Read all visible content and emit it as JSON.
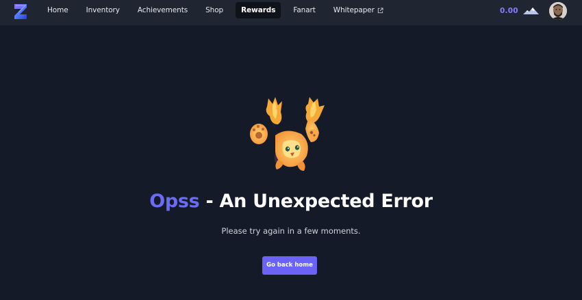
{
  "nav": {
    "items": [
      {
        "label": "Home",
        "active": false
      },
      {
        "label": "Inventory",
        "active": false
      },
      {
        "label": "Achievements",
        "active": false
      },
      {
        "label": "Shop",
        "active": false
      },
      {
        "label": "Rewards",
        "active": true
      },
      {
        "label": "Fanart",
        "active": false
      },
      {
        "label": "Whitepaper",
        "active": false,
        "icon": "external-link-icon"
      }
    ]
  },
  "account": {
    "balance": "0.00",
    "balance_icon": "mountain-token-icon",
    "avatar_icon": "user-avatar"
  },
  "error": {
    "mascot_icon": "fire-creature-mascot",
    "title_accent": "Opss",
    "title_rest": " - An Unexpected Error",
    "message": "Please try again in a few moments.",
    "button_label": "Go back home"
  },
  "colors": {
    "background": "#141a27",
    "topbar": "#202631",
    "accent": "#6b6cf4",
    "button": "#6a63f6",
    "balance": "#8a7cff"
  }
}
